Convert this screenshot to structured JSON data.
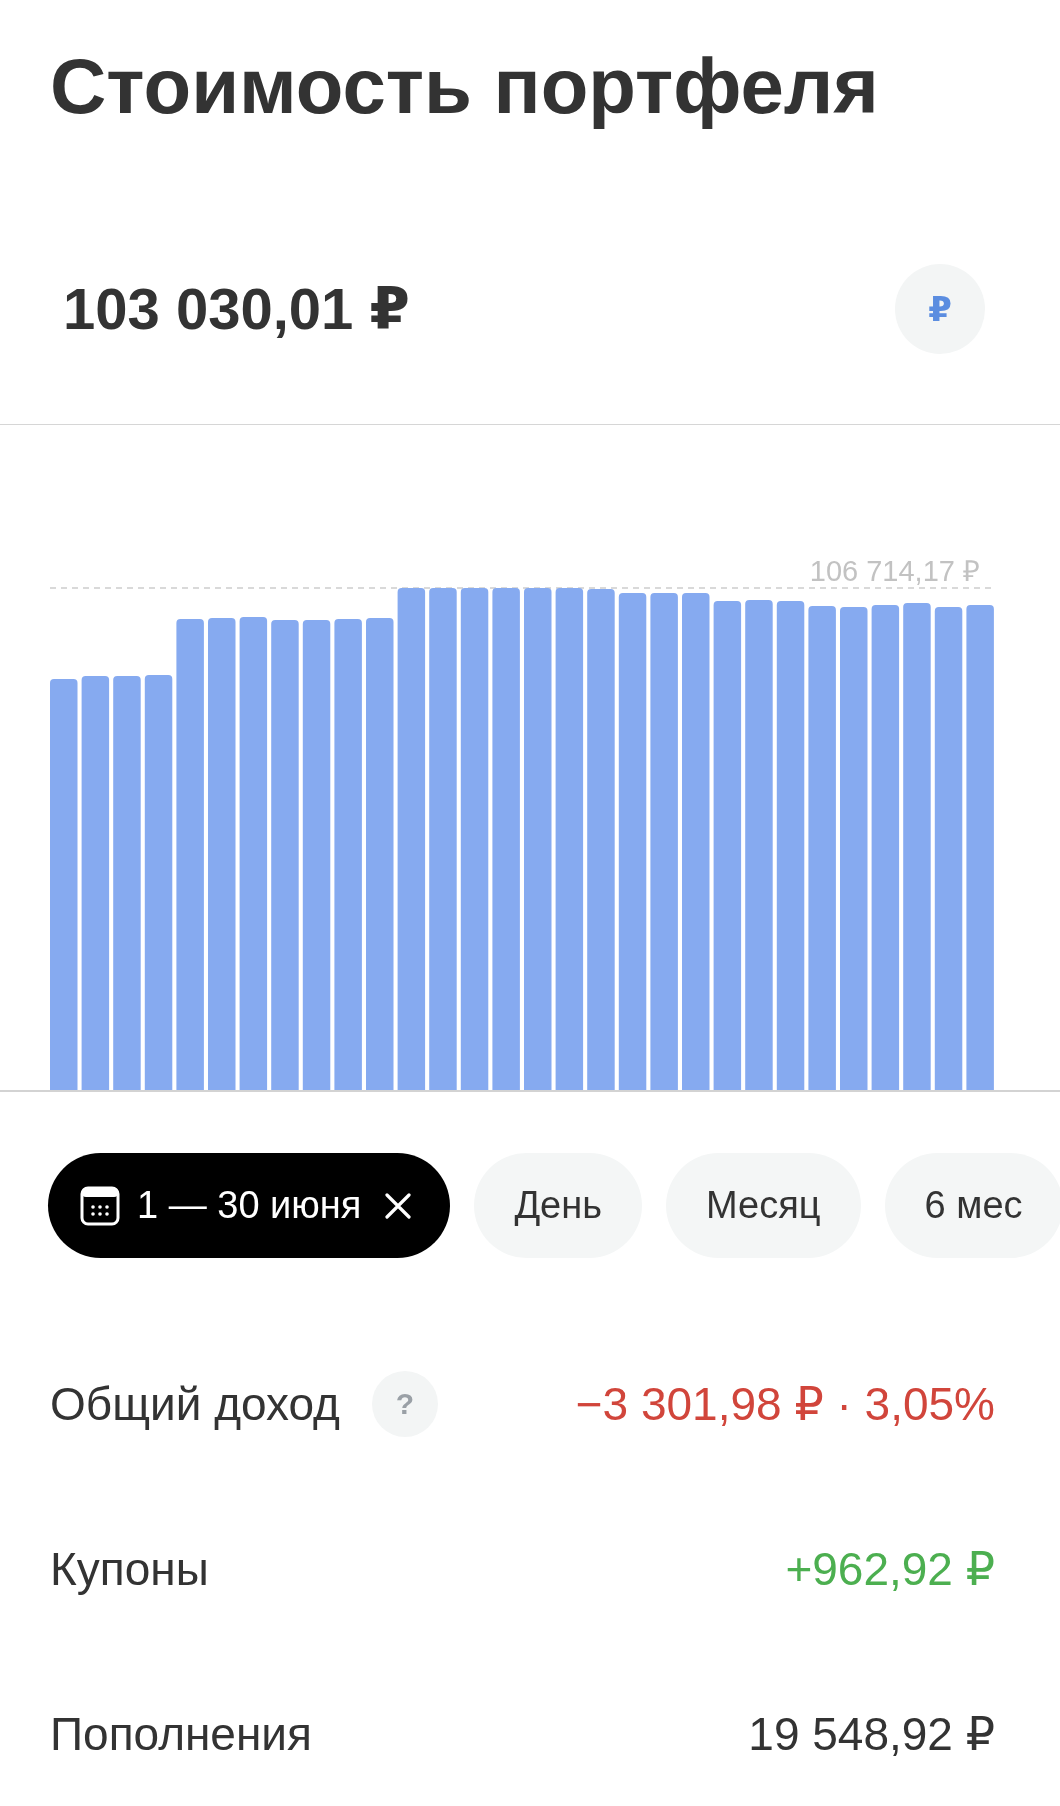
{
  "title": "Стоимость портфеля",
  "portfolio": {
    "value": "103 030,01 ₽",
    "currency_button": "₽"
  },
  "chart": {
    "max_label": "106 714,17 ₽"
  },
  "periods": [
    {
      "kind": "range",
      "label": "1 — 30 июня",
      "selected": true
    },
    {
      "kind": "preset",
      "label": "День",
      "selected": false
    },
    {
      "kind": "preset",
      "label": "Месяц",
      "selected": false
    },
    {
      "kind": "preset",
      "label": "6 мес",
      "selected": false
    }
  ],
  "rows": [
    {
      "label": "Общий доход",
      "help": "?",
      "value": "−3 301,98 ₽ · 3,05%",
      "color": "#d1453b"
    },
    {
      "label": "Купоны",
      "value": "+962,92 ₽",
      "color": "#4caf50"
    },
    {
      "label": "Пополнения",
      "value": "19 548,92 ₽",
      "color": "#333333"
    }
  ]
}
